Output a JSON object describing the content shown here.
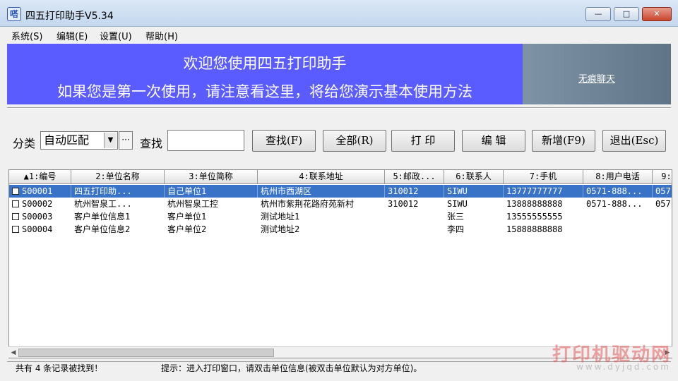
{
  "window": {
    "app_icon_glyph": "嗒",
    "title": "四五打印助手V5.34",
    "minimize_glyph": "—",
    "maximize_glyph": "□",
    "close_glyph": "✕"
  },
  "menu": {
    "items": [
      "系统(S)",
      "编辑(E)",
      "设置(U)",
      "帮助(H)"
    ]
  },
  "banner": {
    "line1": "欢迎您使用四五打印助手",
    "line2": "如果您是第一次使用，请注意看这里，将给您演示基本使用方法",
    "side_link": "无痕聊天"
  },
  "toolbar": {
    "category_label": "分类",
    "category_value": "自动匹配",
    "more_glyph": "···",
    "search_label": "查找",
    "search_value": "",
    "buttons": [
      "查找(F)",
      "全部(R)",
      "打 印",
      "编 辑",
      "新增(F9)",
      "退出(Esc)"
    ]
  },
  "table": {
    "headers": [
      "▲1:编号",
      "2:单位名称",
      "3:单位简称",
      "4:联系地址",
      "5:邮政...",
      "6:联系人",
      "7:手机",
      "8:用户电话",
      "9:"
    ],
    "rows": [
      [
        "S00001",
        "四五打印助...",
        "自己单位1",
        "杭州市西湖区",
        "310012",
        "SIWU",
        "13777777777",
        "0571-888...",
        "057"
      ],
      [
        "S00002",
        "杭州智泉工...",
        "杭州智泉工控",
        "杭州市紫荆花路府苑新村",
        "310012",
        "SIWU",
        "13888888888",
        "0571-888...",
        "057"
      ],
      [
        "S00003",
        "客户单位信息1",
        "客户单位1",
        "测试地址1",
        "",
        "张三",
        "13555555555",
        "",
        ""
      ],
      [
        "S00004",
        "客户单位信息2",
        "客户单位2",
        "测试地址2",
        "",
        "李四",
        "15888888888",
        "",
        ""
      ]
    ],
    "selected_row": 0
  },
  "status": {
    "count_text": "共有 4 条记录被找到！",
    "hint_text": "提示：进入打印窗口，请双击单位信息(被双击单位默认为对方单位)。"
  },
  "watermark": {
    "title": "打印机驱动网",
    "url": "www.dyjqd.com"
  },
  "colors": {
    "banner": "#5b5cff",
    "selection": "#3873c7"
  }
}
